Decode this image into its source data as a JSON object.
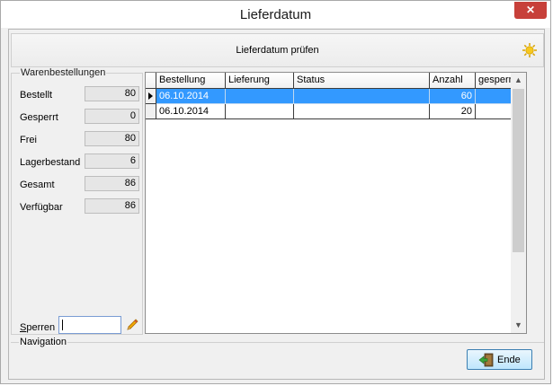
{
  "window": {
    "title": "Lieferdatum",
    "close_symbol": "✕"
  },
  "header": {
    "title": "Lieferdatum prüfen",
    "icon": "sun-icon"
  },
  "orders": {
    "group_title": "Warenbestellungen",
    "rows": [
      {
        "label": "Bestellt",
        "value": "80"
      },
      {
        "label": "Gesperrt",
        "value": "0"
      },
      {
        "label": "Frei",
        "value": "80"
      },
      {
        "label": "Lagerbestand",
        "value": "6"
      },
      {
        "label": "Gesamt",
        "value": "86"
      },
      {
        "label": "Verfügbar",
        "value": "86"
      }
    ],
    "sperren_label": "Sperren",
    "sperren_value": ""
  },
  "grid": {
    "columns": [
      "Bestellung",
      "Lieferung",
      "Status",
      "Anzahl",
      "gesperrt"
    ],
    "rows": [
      {
        "cells": [
          "06.10.2014",
          "",
          "",
          "60",
          ""
        ],
        "selected": true
      },
      {
        "cells": [
          "06.10.2014",
          "",
          "",
          "20",
          ""
        ],
        "selected": false
      }
    ]
  },
  "navigation": {
    "group_title": "Navigation",
    "ende_label": "Ende"
  },
  "colors": {
    "selection": "#3399ff",
    "button_border": "#3c7fb1"
  }
}
